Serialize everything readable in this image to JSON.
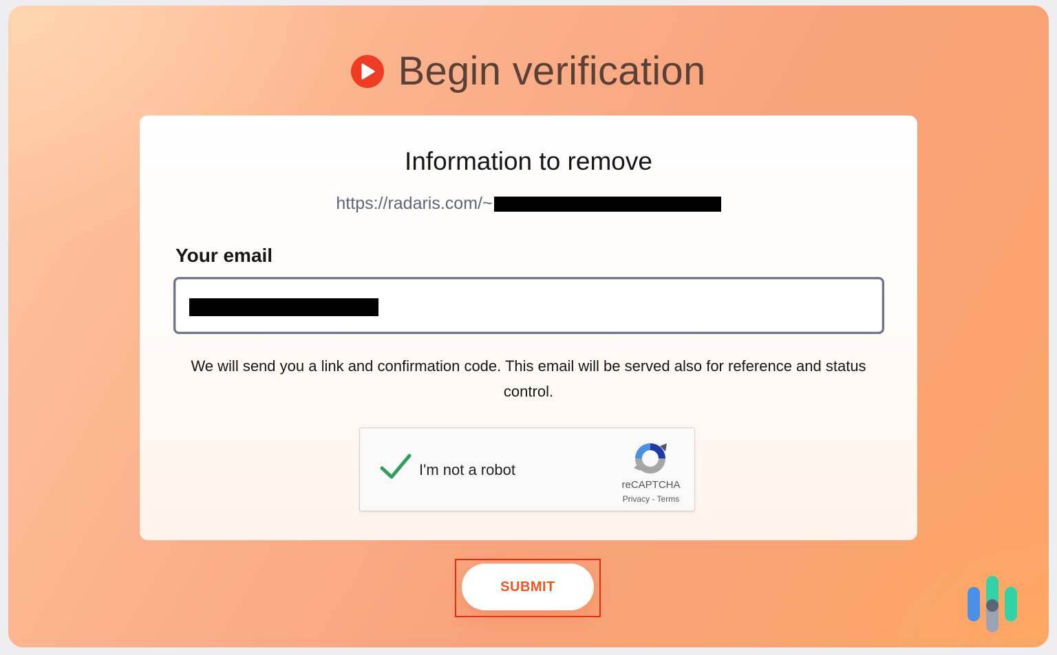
{
  "page": {
    "title": "Begin verification",
    "title_icon": "play-circle-icon",
    "accent": "#ee3b24"
  },
  "card": {
    "heading": "Information to remove",
    "url_prefix": "https://radaris.com/~",
    "email_label": "Your email",
    "helper_text": "We will send you a link and confirmation code. This email will be served also for reference and status control."
  },
  "captcha": {
    "checked": true,
    "label": "I'm not a robot",
    "brand": "reCAPTCHA",
    "links": "Privacy - Terms",
    "check_color": "#2e9e59"
  },
  "actions": {
    "submit_label": "SUBMIT",
    "submit_color": "#f0561c"
  },
  "watermark": {
    "icon": "brand-logo-icon"
  }
}
